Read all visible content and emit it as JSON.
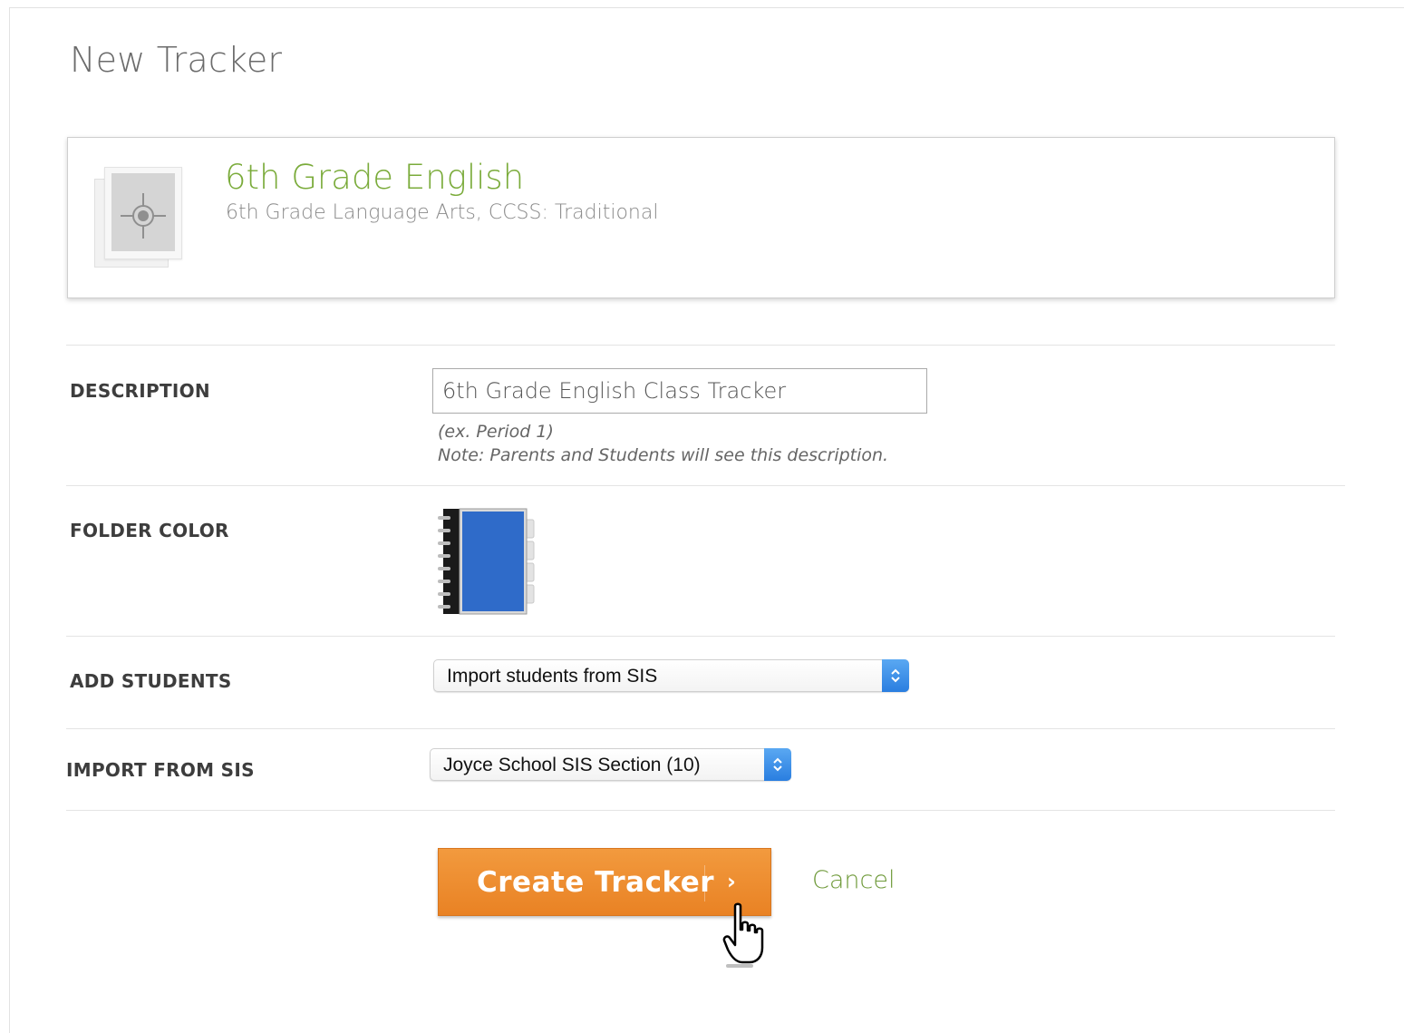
{
  "page": {
    "title": "New Tracker"
  },
  "course": {
    "title": "6th Grade English",
    "subtitle": "6th Grade Language Arts, CCSS: Traditional",
    "icon": "compass-icon"
  },
  "form": {
    "description": {
      "label": "DESCRIPTION",
      "value": "6th Grade English Class Tracker",
      "hint1": "(ex. Period 1)",
      "hint2": "Note: Parents and Students will see this description."
    },
    "folder_color": {
      "label": "FOLDER COLOR",
      "color": "#2f6bc9",
      "icon": "notebook-icon"
    },
    "add_students": {
      "label": "ADD STUDENTS",
      "selected": "Import students from SIS"
    },
    "import_from_sis": {
      "label": "IMPORT FROM SIS",
      "selected": "Joyce School SIS Section (10)"
    }
  },
  "actions": {
    "create_label": "Create Tracker",
    "create_chevron": "›",
    "cancel_label": "Cancel"
  },
  "colors": {
    "accent_green": "#7aab3a",
    "button_orange": "#ee8b2e",
    "select_blue": "#2a7ee0"
  }
}
